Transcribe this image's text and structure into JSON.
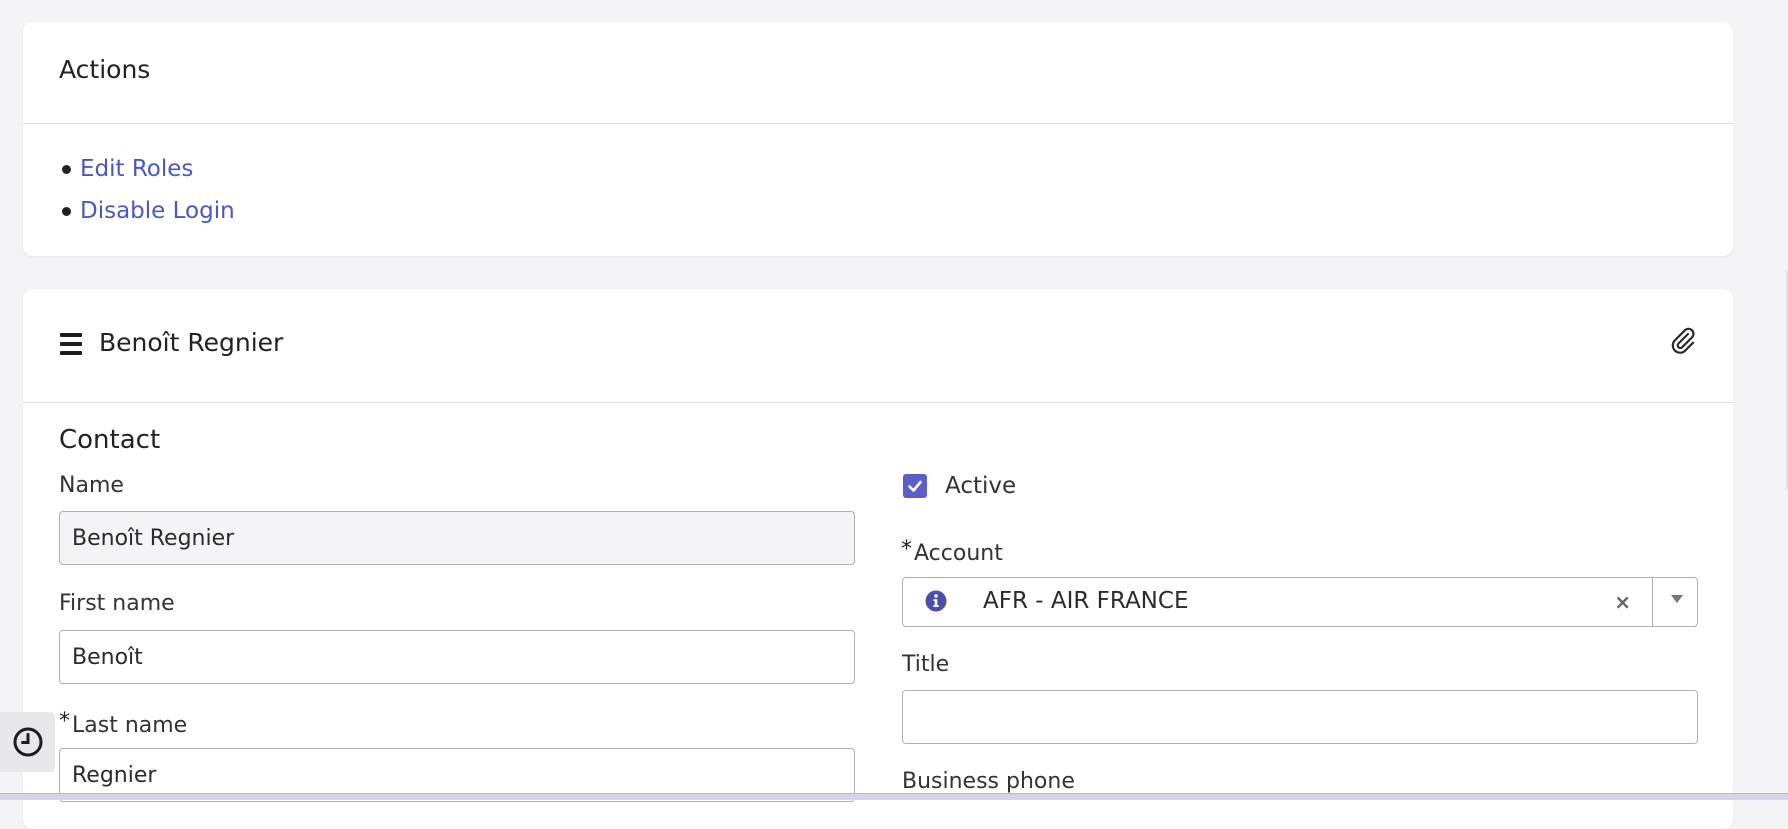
{
  "actions": {
    "title": "Actions",
    "items": [
      {
        "label": "Edit Roles"
      },
      {
        "label": "Disable Login"
      }
    ]
  },
  "record": {
    "title": "Benoît Regnier",
    "section": "Contact",
    "fields": {
      "name": {
        "label": "Name",
        "value": "Benoît Regnier"
      },
      "first_name": {
        "label": "First name",
        "value": "Benoît"
      },
      "last_name": {
        "label": "Last name",
        "required_mark": "*",
        "value": "Regnier"
      },
      "active": {
        "label": "Active",
        "checked": true
      },
      "account": {
        "label": "Account",
        "required_mark": "*",
        "value": "AFR - AIR FRANCE",
        "clear_glyph": "×"
      },
      "title": {
        "label": "Title",
        "value": ""
      },
      "business_phone": {
        "label": "Business phone"
      }
    }
  },
  "icons": {
    "menu": "hamburger-icon",
    "attachment": "paperclip-icon",
    "account_info": "info-icon",
    "history": "clock-icon"
  },
  "colors": {
    "link": "#4b58c0",
    "checkbox": "#5b5fc7",
    "background": "#f4f4f6",
    "card": "#ffffff"
  }
}
